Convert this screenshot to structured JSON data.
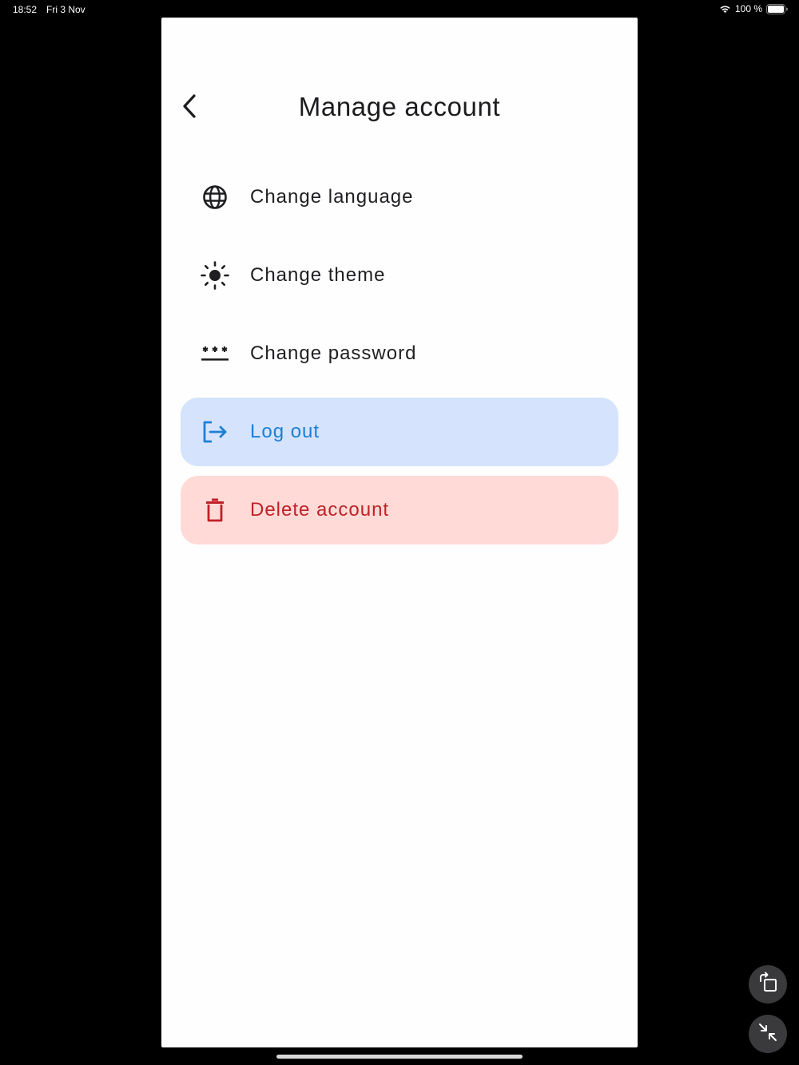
{
  "status_bar": {
    "time": "18:52",
    "date": "Fri 3 Nov",
    "battery": "100 %"
  },
  "header": {
    "title": "Manage account"
  },
  "menu": {
    "items": [
      {
        "label": "Change language",
        "icon": "globe-icon"
      },
      {
        "label": "Change theme",
        "icon": "sun-icon"
      },
      {
        "label": "Change password",
        "icon": "password-icon"
      },
      {
        "label": "Log out",
        "icon": "logout-icon"
      },
      {
        "label": "Delete account",
        "icon": "trash-icon"
      }
    ]
  },
  "colors": {
    "logout_bg": "#d5e3fc",
    "logout_fg": "#1d7fd4",
    "delete_bg": "#ffdad6",
    "delete_fg": "#c12028"
  }
}
